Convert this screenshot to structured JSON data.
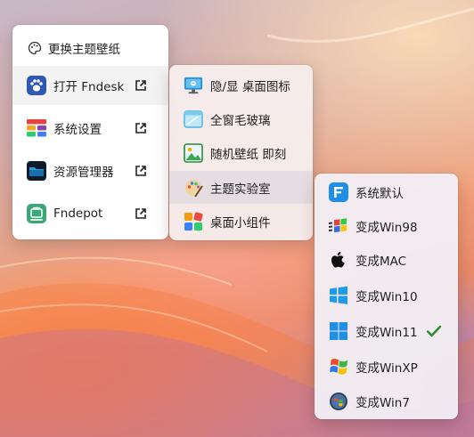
{
  "main_menu": {
    "header": "更换主题壁纸",
    "items": [
      {
        "label": "打开 Fndesk",
        "icon": "paw-icon"
      },
      {
        "label": "系统设置",
        "icon": "settings-icon"
      },
      {
        "label": "资源管理器",
        "icon": "folder-icon"
      },
      {
        "label": "Fndepot",
        "icon": "fndepot-icon"
      }
    ]
  },
  "submenu": {
    "items": [
      {
        "label": "隐/显 桌面图标",
        "icon": "monitor-icon"
      },
      {
        "label": "全窗毛玻璃",
        "icon": "window-glass-icon"
      },
      {
        "label": "随机壁纸 即刻",
        "icon": "image-icon"
      },
      {
        "label": "主题实验室",
        "icon": "palette-icon"
      },
      {
        "label": "桌面小组件",
        "icon": "widget-icon"
      }
    ]
  },
  "theme_menu": {
    "items": [
      {
        "label": "系统默认",
        "icon": "fn-logo-icon"
      },
      {
        "label": "变成Win98",
        "icon": "windows98-icon"
      },
      {
        "label": "变成MAC",
        "icon": "apple-icon"
      },
      {
        "label": "变成Win10",
        "icon": "windows10-icon"
      },
      {
        "label": "变成Win11",
        "icon": "windows11-icon",
        "checked": true
      },
      {
        "label": "变成WinXP",
        "icon": "windowsxp-icon"
      },
      {
        "label": "变成Win7",
        "icon": "windows7-icon"
      }
    ]
  },
  "colors": {
    "check": "#2e8b2e",
    "win_blue": "#1f8fe6"
  }
}
